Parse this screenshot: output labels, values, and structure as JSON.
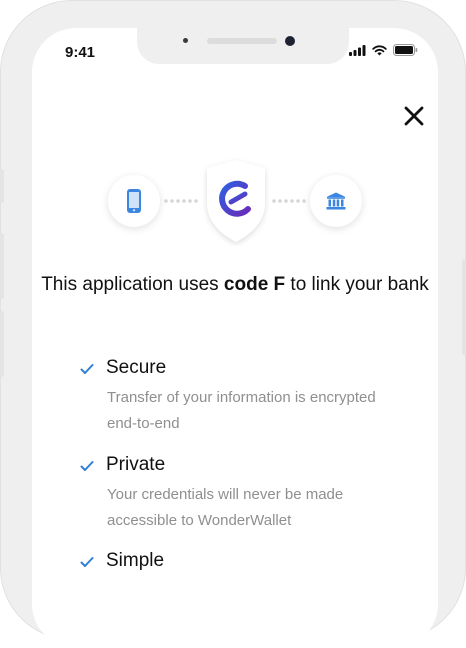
{
  "status_bar": {
    "time": "9:41"
  },
  "headline": {
    "prefix": "This application uses ",
    "brand": "code F",
    "suffix": " to link your bank"
  },
  "features": [
    {
      "title": "Secure",
      "description": "Transfer of your information is encrypted end-to-end"
    },
    {
      "title": "Private",
      "description": "Your credentials will never be made accessible to WonderWallet"
    },
    {
      "title": "Simple",
      "description": ""
    }
  ],
  "colors": {
    "accent": "#2f7fd6",
    "brand_gradient_start": "#2e5fe0",
    "brand_gradient_end": "#6a2bb8"
  },
  "icons": [
    "phone-icon",
    "brand-logo-icon",
    "bank-icon",
    "close-icon",
    "check-icon"
  ]
}
